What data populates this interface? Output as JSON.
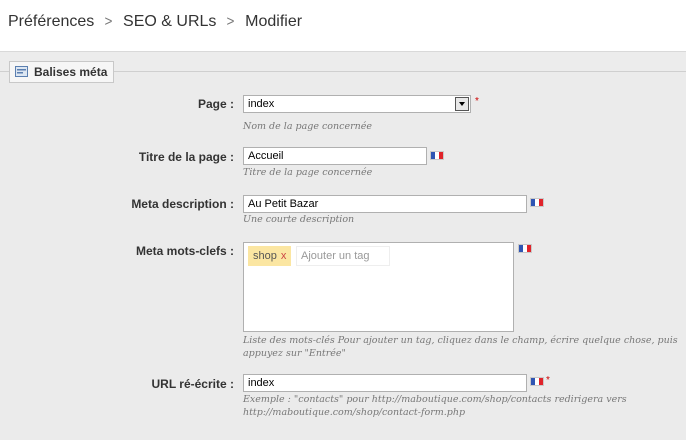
{
  "breadcrumb": {
    "items": [
      "Préférences",
      "SEO & URLs",
      "Modifier"
    ],
    "separator": ">"
  },
  "section": {
    "title": "Balises méta",
    "icon": "card-icon"
  },
  "fields": {
    "page": {
      "label": "Page :",
      "value": "index",
      "help": "Nom de la page concernée",
      "required": "*"
    },
    "title": {
      "label": "Titre de la page :",
      "value": "Accueil",
      "help": "Titre de la page concernée"
    },
    "description": {
      "label": "Meta description :",
      "value": "Au Petit Bazar",
      "help": "Une courte description"
    },
    "keywords": {
      "label": "Meta mots-clefs :",
      "tags": [
        {
          "text": "shop",
          "remove": "x"
        }
      ],
      "placeholder": "Ajouter un tag",
      "help_line1": "Liste des mots-clés Pour ajouter un tag, cliquez dans le champ, écrire quelque chose, puis",
      "help_line2": "appuyez sur \"Entrée\""
    },
    "url": {
      "label": "URL ré-écrite :",
      "value": "index",
      "required": "*",
      "help_line1": "Exemple : \"contacts\" pour http://maboutique.com/shop/contacts redirigera vers",
      "help_line2": "http://maboutique.com/shop/contact-form.php"
    }
  },
  "colors": {
    "flag_blue": "#2f55b3",
    "flag_white": "#ffffff",
    "flag_red": "#e0232a",
    "required": "#cc0000",
    "tag_bg": "#fbe6a2"
  }
}
